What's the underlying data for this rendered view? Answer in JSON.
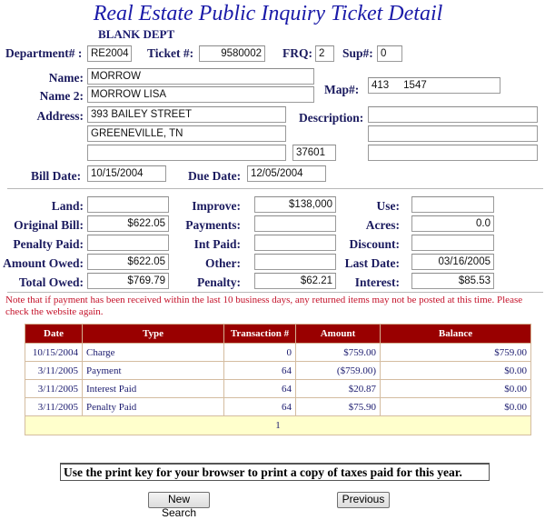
{
  "header": {
    "title": "Real Estate Public Inquiry Ticket Detail",
    "subtitle": "BLANK DEPT"
  },
  "ticket": {
    "department_label": "Department# :",
    "department": "RE2004",
    "ticket_label": "Ticket #:",
    "ticket": "9580002",
    "frq_label": "FRQ:",
    "frq": "2",
    "sup_label": "Sup#:",
    "sup": "0"
  },
  "owner": {
    "name_label": "Name:",
    "name": "MORROW",
    "name2_label": "Name 2:",
    "name2": "MORROW LISA",
    "map_label": "Map#:",
    "map": "413     1547",
    "address_label": "Address:",
    "address1": "393 BAILEY STREET",
    "address2": "GREENEVILLE, TN",
    "address3": "",
    "zip": "37601",
    "description_label": "Description:",
    "description1": "",
    "description2": "",
    "description3": "",
    "bill_date_label": "Bill Date:",
    "bill_date": "10/15/2004",
    "due_date_label": "Due Date:",
    "due_date": "12/05/2004"
  },
  "amounts": {
    "col1": [
      {
        "label": "Land:",
        "value": ""
      },
      {
        "label": "Original Bill:",
        "value": "$622.05"
      },
      {
        "label": "Penalty Paid:",
        "value": ""
      },
      {
        "label": "Amount Owed:",
        "value": "$622.05"
      },
      {
        "label": "Total Owed:",
        "value": "$769.79"
      }
    ],
    "col2": [
      {
        "label": "Improve:",
        "value": "$138,000"
      },
      {
        "label": "Payments:",
        "value": ""
      },
      {
        "label": "Int Paid:",
        "value": ""
      },
      {
        "label": "Other:",
        "value": ""
      },
      {
        "label": "Penalty:",
        "value": "$62.21"
      }
    ],
    "col3": [
      {
        "label": "Use:",
        "value": ""
      },
      {
        "label": "Acres:",
        "value": "0.0"
      },
      {
        "label": "Discount:",
        "value": ""
      },
      {
        "label": "Last Date:",
        "value": "03/16/2005"
      },
      {
        "label": "Interest:",
        "value": "$85.53"
      }
    ]
  },
  "note": "Note that if payment has been received within the last 10 business days, any returned items may not be posted at this time. Please check the website again.",
  "transactions": {
    "headers": [
      "Date",
      "Type",
      "Transaction #",
      "Amount",
      "Balance"
    ],
    "rows": [
      {
        "date": "10/15/2004",
        "type": "Charge",
        "txn": "0",
        "amount": "$759.00",
        "balance": "$759.00"
      },
      {
        "date": "3/11/2005",
        "type": "Payment",
        "txn": "64",
        "amount": "($759.00)",
        "balance": "$0.00"
      },
      {
        "date": "3/11/2005",
        "type": "Interest Paid",
        "txn": "64",
        "amount": "$20.87",
        "balance": "$0.00"
      },
      {
        "date": "3/11/2005",
        "type": "Penalty Paid",
        "txn": "64",
        "amount": "$75.90",
        "balance": "$0.00"
      }
    ],
    "page": "1"
  },
  "footer": {
    "print_message": "Use the print key for your browser to print a copy of taxes paid for this year.",
    "new_search_label": "New Search",
    "previous_label": "Previous"
  },
  "colors": {
    "title": "#1a1aa8",
    "label": "#1a1a5e",
    "table_header": "#990000",
    "note": "#c4122a",
    "pager_row": "#ffffcc"
  }
}
